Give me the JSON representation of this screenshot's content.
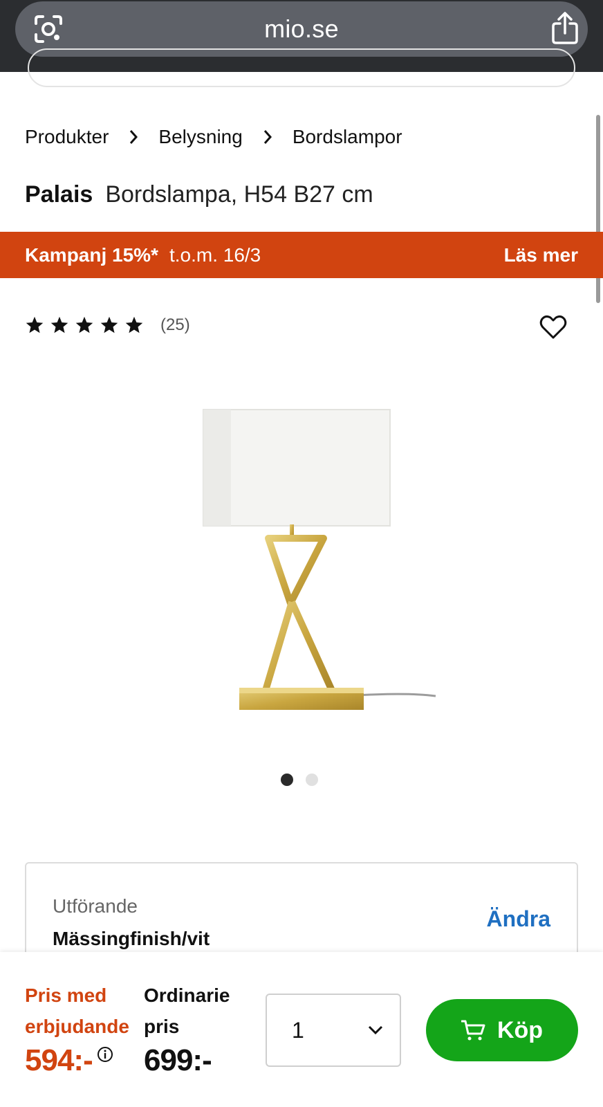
{
  "browser": {
    "url": "mio.se"
  },
  "breadcrumb": [
    "Produkter",
    "Belysning",
    "Bordslampor"
  ],
  "product": {
    "brand": "Palais",
    "description": "Bordslampa, H54 B27 cm",
    "rating_stars": 5,
    "review_count": "(25)"
  },
  "promo": {
    "campaign": "Kampanj 15%*",
    "date": "t.o.m. 16/3",
    "more": "Läs mer",
    "background": "#d14410"
  },
  "gallery": {
    "images": 2,
    "active_index": 0
  },
  "variant": {
    "label": "Utförande",
    "value": "Mässingfinish/vit",
    "change": "Ändra"
  },
  "purchase": {
    "offer_label": "Pris med erbjudande",
    "offer_price": "594:-",
    "regular_label": "Ordinarie pris",
    "regular_price": "699:-",
    "quantity": "1",
    "buy_label": "Köp",
    "buy_color": "#14a519"
  }
}
